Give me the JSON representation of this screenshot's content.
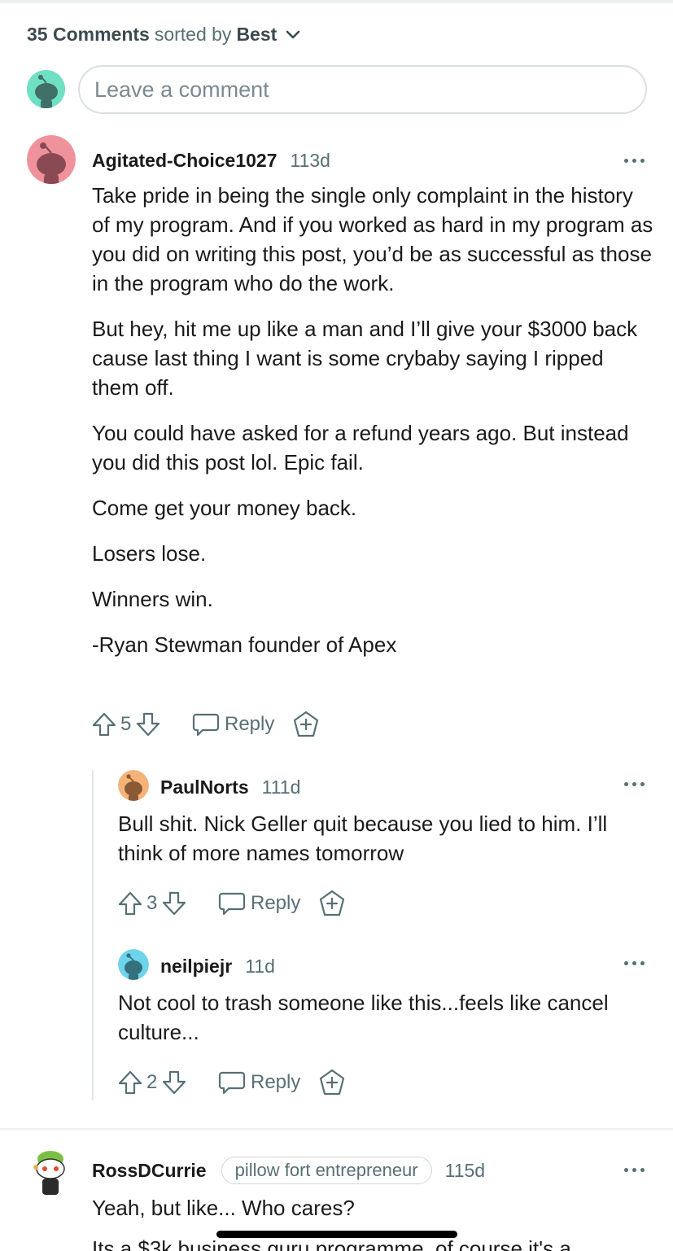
{
  "header": {
    "comment_count": "35 Comments",
    "sorted_by": "sorted by",
    "sort_value": "Best"
  },
  "composer": {
    "placeholder": "Leave a comment"
  },
  "comments": [
    {
      "user": "Agitated-Choice1027",
      "age": "113d",
      "avatar_color": "#f0929b",
      "paragraphs": [
        "Take pride in being the single only complaint in the history of my program. And if you worked as hard in my program as you did on writing this post, you’d be as successful as those in the program who do the work.",
        "But hey, hit me up like a man and I’ll give your $3000 back cause last thing I want is some crybaby saying I ripped them off.",
        "You could have asked for a refund years ago. But instead you did this post lol. Epic fail.",
        "Come get your money back.",
        "Losers lose.",
        "Winners win.",
        "-Ryan Stewman founder of Apex"
      ],
      "score": "5",
      "reply_label": "Reply"
    },
    {
      "user": "PaulNorts",
      "age": "111d",
      "avatar_color": "#f5b37a",
      "paragraphs": [
        "Bull shit. Nick Geller quit because you lied to him. I’ll think of more names tomorrow"
      ],
      "score": "3",
      "reply_label": "Reply"
    },
    {
      "user": "neilpiejr",
      "age": "11d",
      "avatar_color": "#6fd4ea",
      "paragraphs": [
        "Not cool to trash someone like this...feels like cancel culture..."
      ],
      "score": "2",
      "reply_label": "Reply"
    },
    {
      "user": "RossDCurrie",
      "flair": "pillow fort entrepreneur",
      "age": "115d",
      "paragraphs": [
        "Yeah, but like... Who cares?"
      ],
      "cut_text": "Its a $3k business guru programme, of course it's a"
    }
  ],
  "colors": {
    "text_primary": "#1a1a1b",
    "text_secondary": "#576f76",
    "thread_line": "#e4e7e9"
  }
}
